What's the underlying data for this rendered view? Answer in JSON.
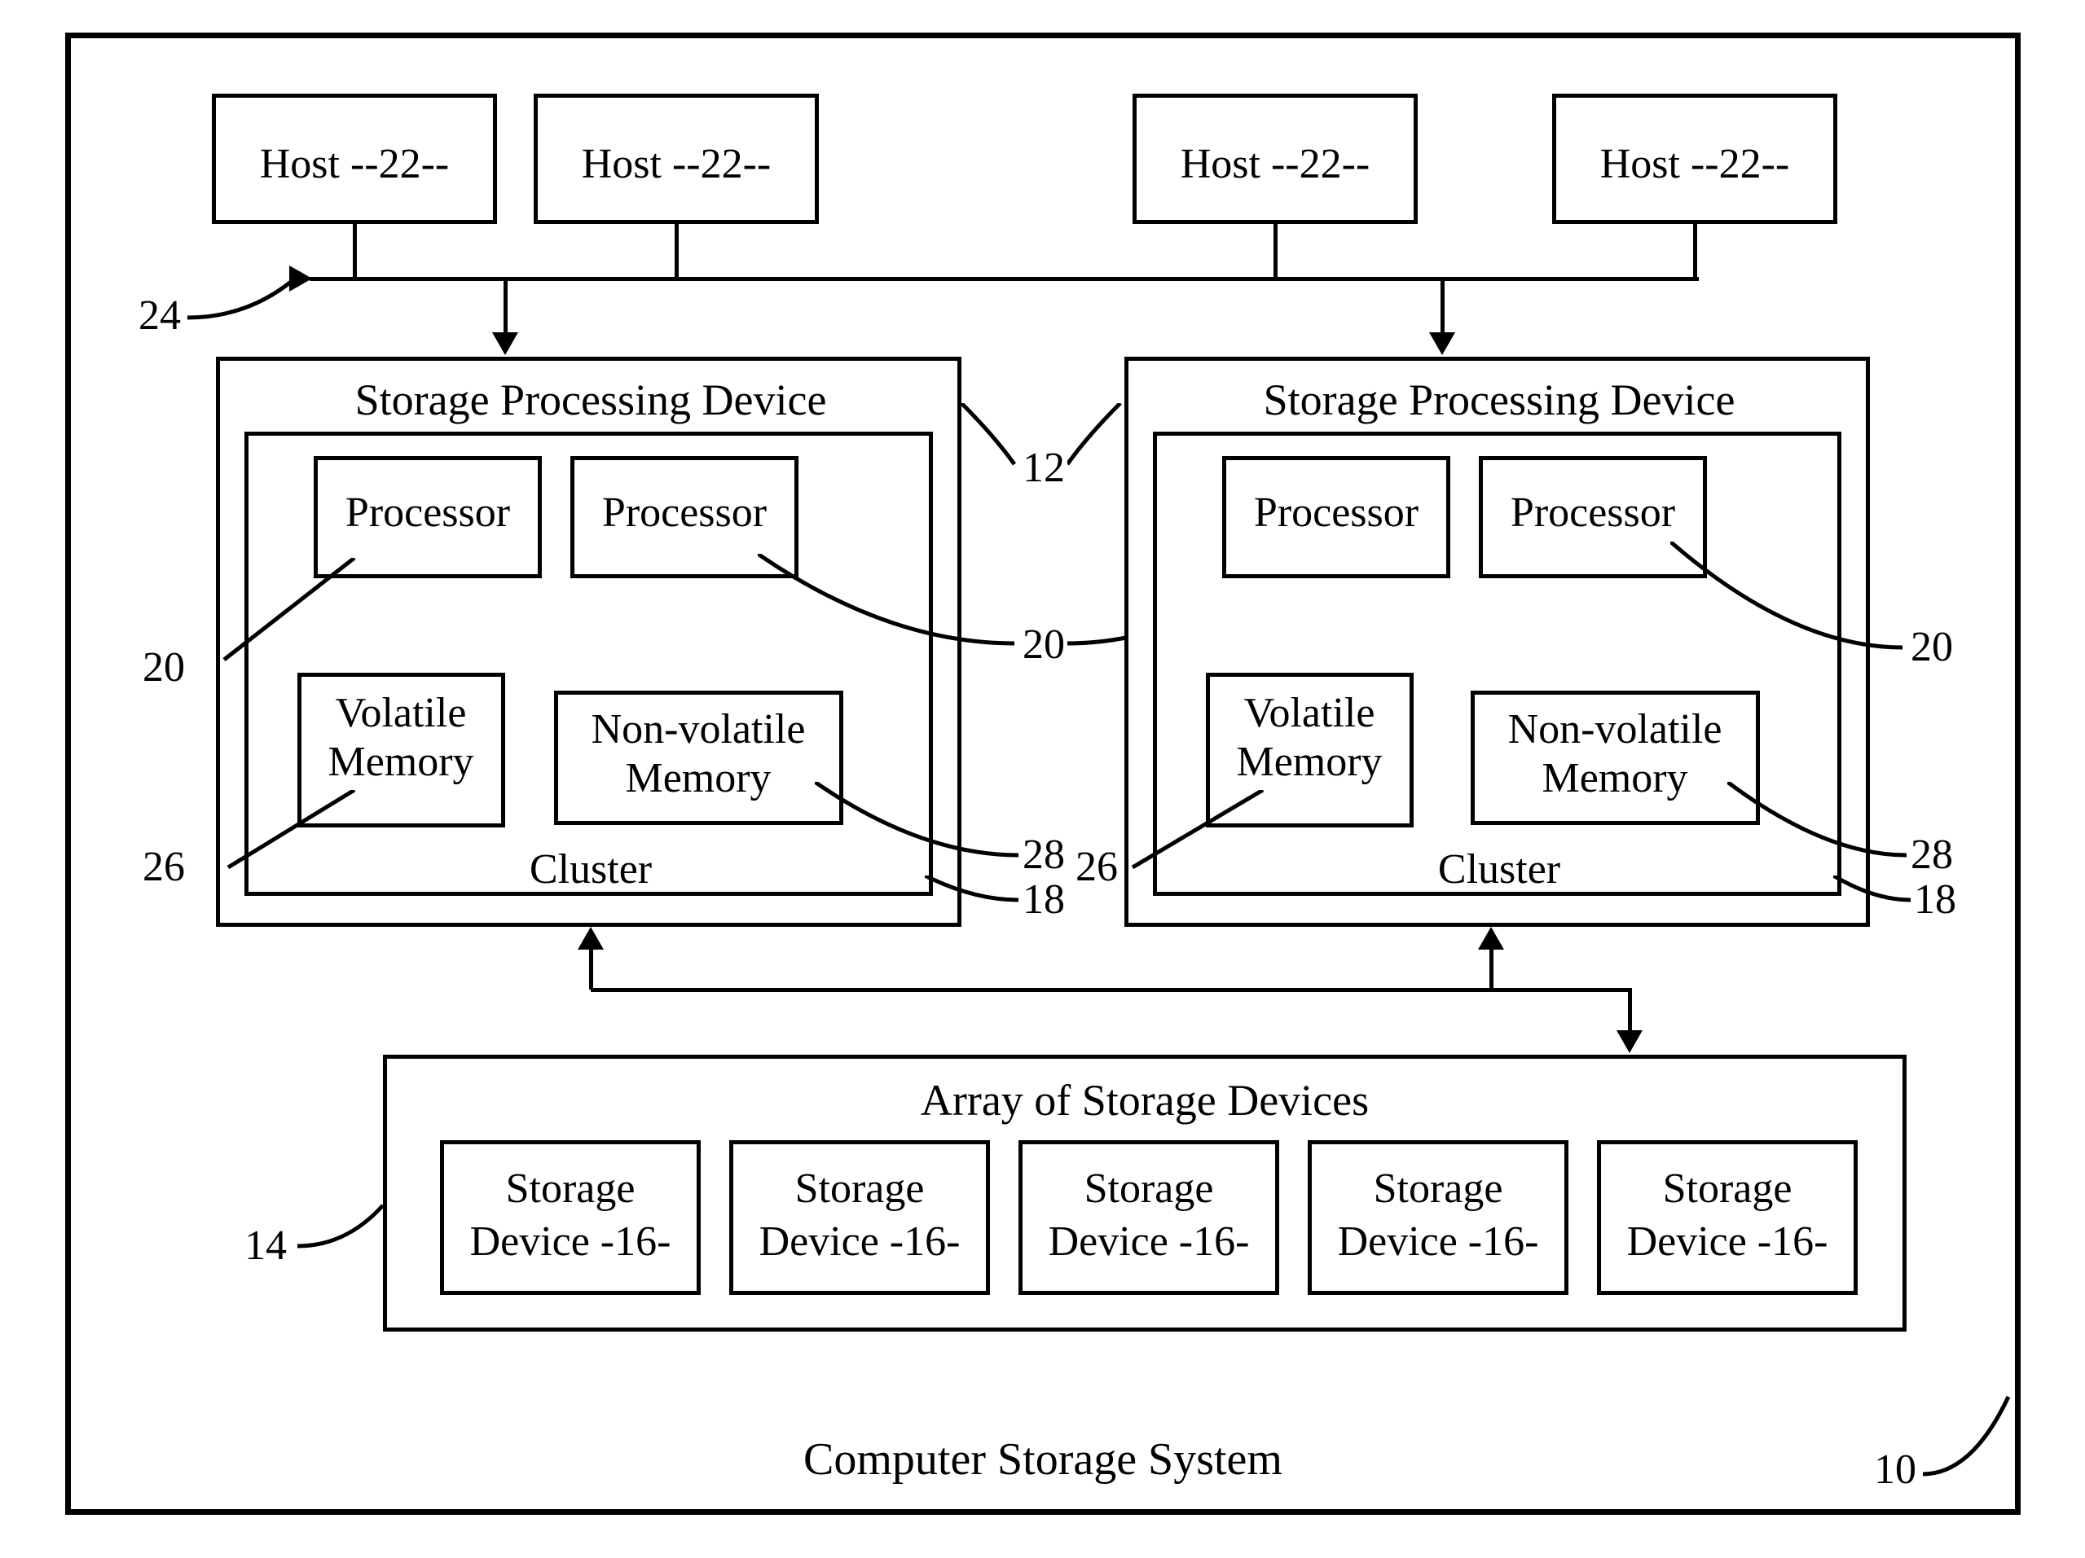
{
  "system": {
    "title": "Computer Storage System",
    "ref": "10"
  },
  "hosts": {
    "label1": "Host  --22--",
    "label2": "Host  --22--",
    "label3": "Host  --22--",
    "label4": "Host  --22--"
  },
  "front_bus": {
    "ref": "24"
  },
  "spd": {
    "title1": "Storage Processing Device",
    "title2": "Storage Processing Device",
    "ref": "12",
    "cluster": {
      "title": "Cluster",
      "ref": "18"
    },
    "processor": {
      "label": "Processor",
      "ref": "20"
    },
    "volmem": {
      "line1": "Volatile",
      "line2": "Memory",
      "ref": "26"
    },
    "nvmem": {
      "line1": "Non-volatile",
      "line2": "Memory",
      "ref": "28"
    }
  },
  "array": {
    "title": "Array of Storage Devices",
    "ref": "14",
    "device": {
      "line1": "Storage",
      "line2": "Device -16-"
    }
  }
}
